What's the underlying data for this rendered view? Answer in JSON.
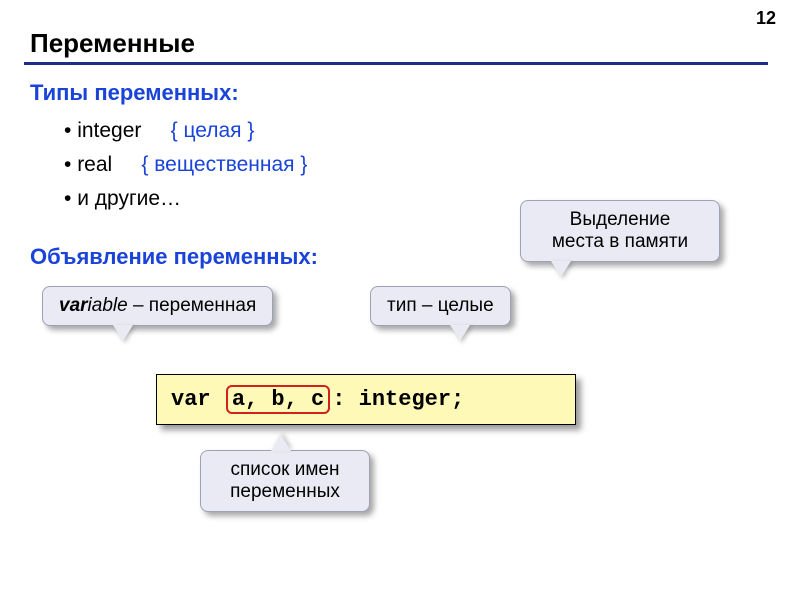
{
  "page_number": "12",
  "title": "Переменные",
  "section1": "Типы переменных:",
  "section2": "Объявление переменных:",
  "bullets": {
    "b1_type": "integer",
    "b1_comment": "{ целая }",
    "b2_type": "real",
    "b2_comment": "{ вещественная }",
    "b3_text": "и другие…"
  },
  "callouts": {
    "variable_prefix_bold": "var",
    "variable_prefix_rest": "iable",
    "variable_dash": " – переменная",
    "type_int": "тип – целые",
    "mem_line1": "Выделение",
    "mem_line2": "места в памяти",
    "names_line1": "список имен",
    "names_line2": "переменных"
  },
  "code": {
    "kw": "var ",
    "names": "a, b, c",
    "tail": ": integer;"
  }
}
